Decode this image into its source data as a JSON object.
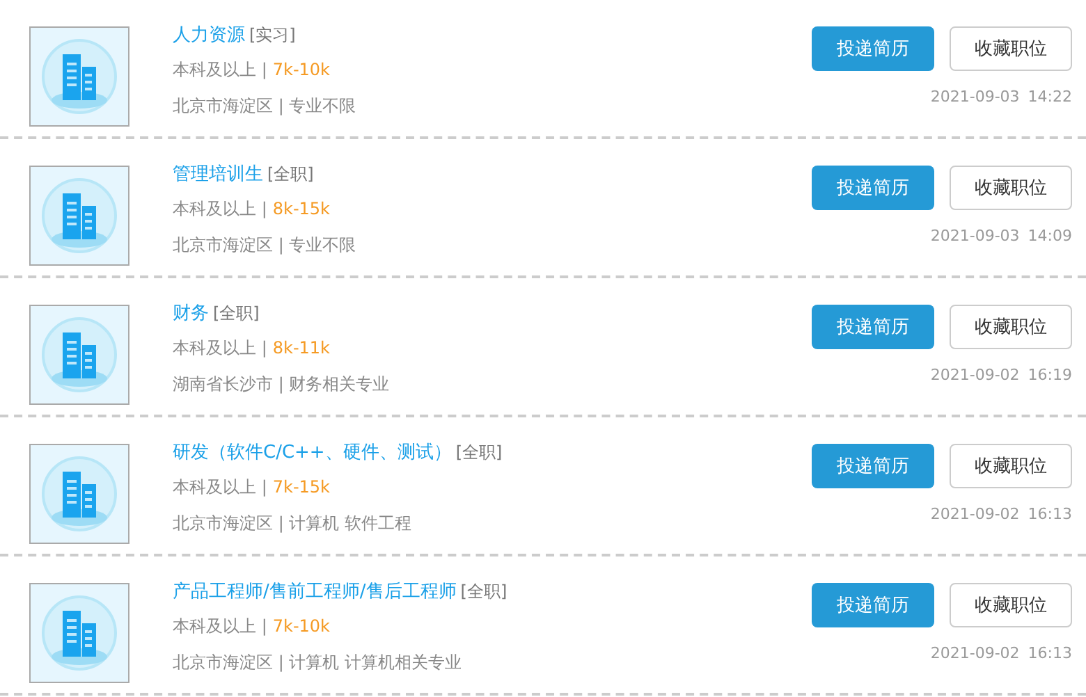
{
  "jobs": [
    {
      "title": "人力资源",
      "type": "[实习]",
      "education": "本科及以上 |",
      "salary": "7k-10k",
      "location": "北京市海淀区 | 专业不限",
      "apply": "投递简历",
      "save": "收藏职位",
      "date": "2021-09-03",
      "time": "14:22"
    },
    {
      "title": "管理培训生",
      "type": "[全职]",
      "education": "本科及以上 |",
      "salary": "8k-15k",
      "location": "北京市海淀区 | 专业不限",
      "apply": "投递简历",
      "save": "收藏职位",
      "date": "2021-09-03",
      "time": "14:09"
    },
    {
      "title": "财务",
      "type": "[全职]",
      "education": "本科及以上 |",
      "salary": "8k-11k",
      "location": "湖南省长沙市 | 财务相关专业",
      "apply": "投递简历",
      "save": "收藏职位",
      "date": "2021-09-02",
      "time": "16:19"
    },
    {
      "title": "研发（软件C/C++、硬件、测试）",
      "type": "[全职]",
      "education": "本科及以上 |",
      "salary": "7k-15k",
      "location": "北京市海淀区 | 计算机 软件工程",
      "apply": "投递简历",
      "save": "收藏职位",
      "date": "2021-09-02",
      "time": "16:13"
    },
    {
      "title": "产品工程师/售前工程师/售后工程师",
      "type": "[全职]",
      "education": "本科及以上 |",
      "salary": "7k-10k",
      "location": "北京市海淀区 | 计算机 计算机相关专业",
      "apply": "投递简历",
      "save": "收藏职位",
      "date": "2021-09-02",
      "time": "16:13"
    }
  ]
}
